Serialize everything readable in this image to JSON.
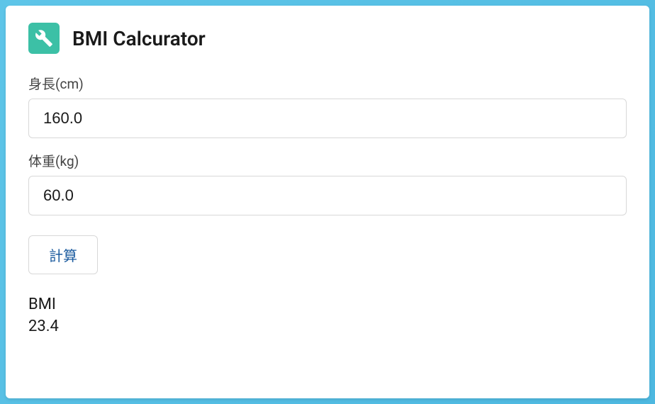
{
  "header": {
    "title": "BMI Calcurator",
    "icon": "wrench-icon"
  },
  "form": {
    "height": {
      "label": "身長(cm)",
      "value": "160.0"
    },
    "weight": {
      "label": "体重(kg)",
      "value": "60.0"
    },
    "calculate_label": "計算"
  },
  "result": {
    "label": "BMI",
    "value": "23.4"
  }
}
